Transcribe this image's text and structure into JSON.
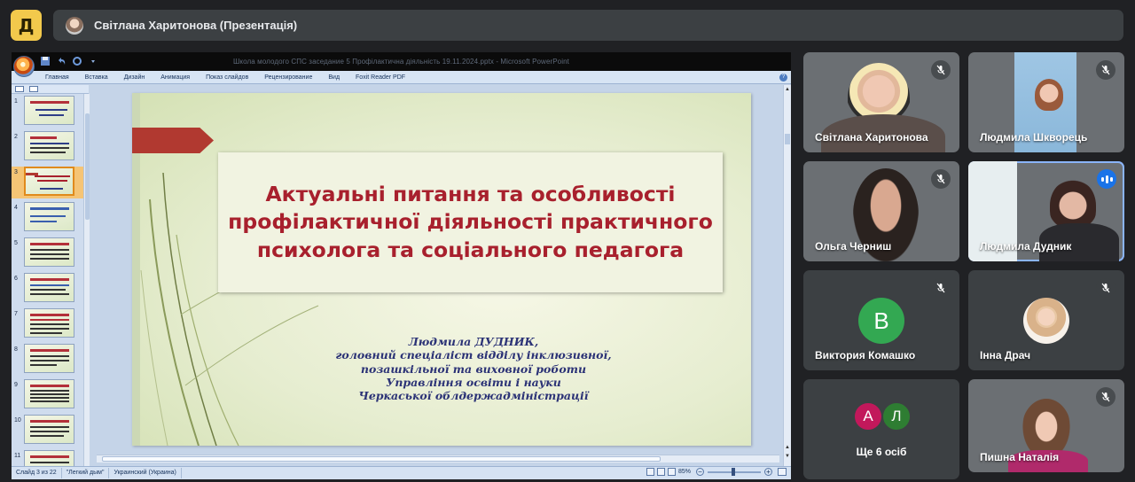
{
  "app": {
    "logo_glyph": "Д",
    "presentation_title": "Світлана Харитонова (Презентація)"
  },
  "ppt": {
    "window_title": "Школа молодого СПС заседание 5 Профілактична діяльність 19.11.2024.pptx - Microsoft PowerPoint",
    "office_button_icon": "office-orb-icon",
    "ribbon_tabs": [
      "Главная",
      "Вставка",
      "Дизайн",
      "Анимация",
      "Показ слайдов",
      "Рецензирование",
      "Вид",
      "Foxit Reader PDF"
    ],
    "help_glyph": "?",
    "thumbnails": [
      {
        "num": "1"
      },
      {
        "num": "2"
      },
      {
        "num": "3"
      },
      {
        "num": "4"
      },
      {
        "num": "5"
      },
      {
        "num": "6"
      },
      {
        "num": "7"
      },
      {
        "num": "8"
      },
      {
        "num": "9"
      },
      {
        "num": "10"
      },
      {
        "num": "11"
      }
    ],
    "active_thumbnail": 3,
    "slide": {
      "title": "Актуальні питання та особливості профілактичної діяльності практичного психолога та соціального педагога",
      "author_lines": [
        "Людмила ДУДНИК,",
        "головний спеціаліст відділу інклюзивної,",
        "позашкільної та виховної роботи",
        "Управління освіти і науки",
        "Черкаської облдержадміністрації"
      ]
    },
    "status": {
      "slide_counter": "Слайд 3 из 22",
      "theme": "\"Легкий дым\"",
      "language": "Украинский (Украина)",
      "zoom": "85%",
      "zoom_minus": "−",
      "zoom_plus": "+"
    }
  },
  "participants": [
    {
      "name": "Світлана Харитонова",
      "muted": true,
      "has_video": true
    },
    {
      "name": "Людмила Шкворець",
      "muted": true,
      "has_video": true
    },
    {
      "name": "Ольга Черниш",
      "muted": true,
      "has_video": true
    },
    {
      "name": "Людмила Дудник",
      "muted": false,
      "speaking": true,
      "has_video": true
    },
    {
      "name": "Виктория Комашко",
      "muted": true,
      "has_video": false,
      "initial": "В",
      "avatar_color": "#33a852"
    },
    {
      "name": "Інна Драч",
      "muted": true,
      "has_video": false
    },
    {
      "name": "Пишна Наталія",
      "muted": true,
      "has_video": true
    }
  ],
  "others": {
    "initials": [
      {
        "letter": "А",
        "color": "#c2185b"
      },
      {
        "letter": "Л",
        "color": "#2e7d32"
      }
    ],
    "label": "Ще 6 осіб"
  },
  "colors": {
    "background": "#202124",
    "tile": "#3c4043",
    "accent_speaking": "#1a73e8",
    "slide_title": "#a8202d",
    "slide_author": "#2b3276",
    "logo": "#f2c94c"
  }
}
